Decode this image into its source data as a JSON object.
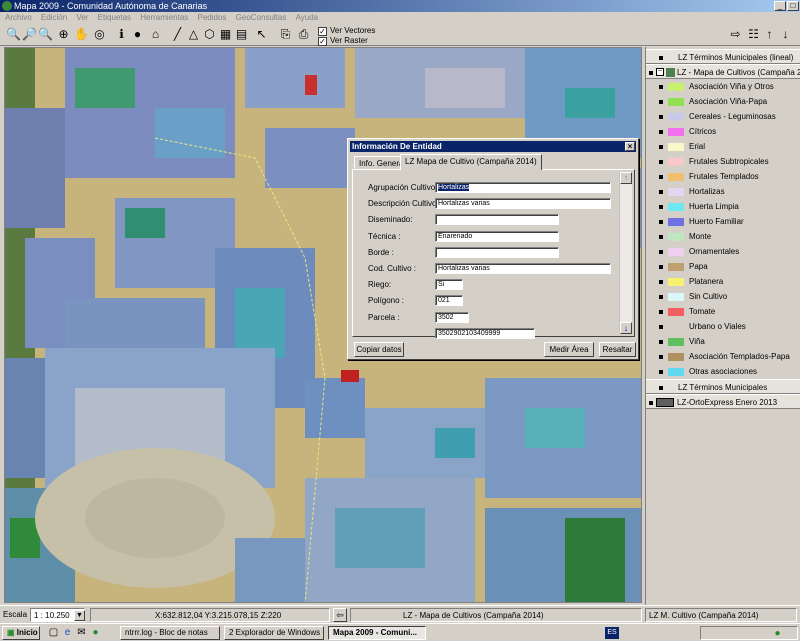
{
  "window": {
    "title": "Mapa  2009 - Comunidad Autónoma de Canarias"
  },
  "menu": [
    "Archivo",
    "Edición",
    "Ver",
    "Etiquetas",
    "Herramientas",
    "Pedidos",
    "GeoConsultas",
    "Ayuda"
  ],
  "toolbar": {
    "ver_vectores": "Ver Vectores",
    "ver_raster": "Ver Raster"
  },
  "legend": {
    "layer1": "LZ Términos Municipales (lineal)",
    "layer2": "LZ - Mapa de Cultivos (Campaña 2014)",
    "items": [
      {
        "label": "Asociación Viña y Otros",
        "color": "#c8f070"
      },
      {
        "label": "Asociación Viña-Papa",
        "color": "#90e050"
      },
      {
        "label": "Cereales - Leguminosas",
        "color": "#c8c8e8"
      },
      {
        "label": "Cítricos",
        "color": "#f070f0"
      },
      {
        "label": "Erial",
        "color": "#f8f8c8"
      },
      {
        "label": "Frutales Subtropicales",
        "color": "#f8c8c8"
      },
      {
        "label": "Frutales Templados",
        "color": "#f0c070"
      },
      {
        "label": "Hortalizas",
        "color": "#e0d8f0"
      },
      {
        "label": "Huerta Limpia",
        "color": "#70e8f0"
      },
      {
        "label": "Huerto Familiar",
        "color": "#7070e0"
      },
      {
        "label": "Monte",
        "color": "#c0e8c0"
      },
      {
        "label": "Ornamentales",
        "color": "#f0d0f0"
      },
      {
        "label": "Papa",
        "color": "#c0a070"
      },
      {
        "label": "Platanera",
        "color": "#f8f070"
      },
      {
        "label": "Sin Cultivo",
        "color": "#d8f8f8"
      },
      {
        "label": "Tomate",
        "color": "#f06060"
      },
      {
        "label": "Urbano o Viales",
        "color": "#d4d0c8"
      },
      {
        "label": "Viña",
        "color": "#60c060"
      },
      {
        "label": "Asociación Templados-Papa",
        "color": "#b09060"
      },
      {
        "label": "Otras asociaciones",
        "color": "#60d8f0"
      }
    ],
    "layer3": "LZ Términos Municipales",
    "layer4": "LZ-OrtoExpress Enero 2013"
  },
  "dialog": {
    "title": "Información De Entidad",
    "tab_general": "Info. General",
    "tab_layer": "LZ Mapa de Cultivo (Campaña 2014)",
    "fields": [
      {
        "label": "Agrupación Cultivo :",
        "value": "Hortalizas"
      },
      {
        "label": "Descripción Cultivo :",
        "value": "Hortalizas varias"
      },
      {
        "label": "Diseminado:",
        "value": ""
      },
      {
        "label": "Técnica :",
        "value": "Enarenado"
      },
      {
        "label": "Borde :",
        "value": ""
      },
      {
        "label": "Cod. Cultivo :",
        "value": "Hortalizas varias"
      },
      {
        "label": "Riego:",
        "value": "Si"
      },
      {
        "label": "Polígono :",
        "value": "021"
      },
      {
        "label": "Parcela :",
        "value": "3502"
      },
      {
        "label": "",
        "value": "3502902103409999"
      }
    ],
    "btn_copy": "Copiar datos",
    "btn_area": "Medir Área",
    "btn_highlight": "Resaltar"
  },
  "status": {
    "scale_label": "Escala",
    "scale_value": "1 : 10.250",
    "coords": "X:632.812,04  Y:3.215.078,15  Z:220",
    "layer_active": "LZ - Mapa de Cultivos (Campaña 2014)",
    "layer_right": "LZ M. Cultivo (Campaña 2014)"
  },
  "taskbar": {
    "start": "Inicio",
    "tasks": [
      "ntrrr.log - Bloc de notas",
      "2 Explorador de Windows",
      "Mapa  2009 - Comuni..."
    ],
    "lang": "ES"
  }
}
